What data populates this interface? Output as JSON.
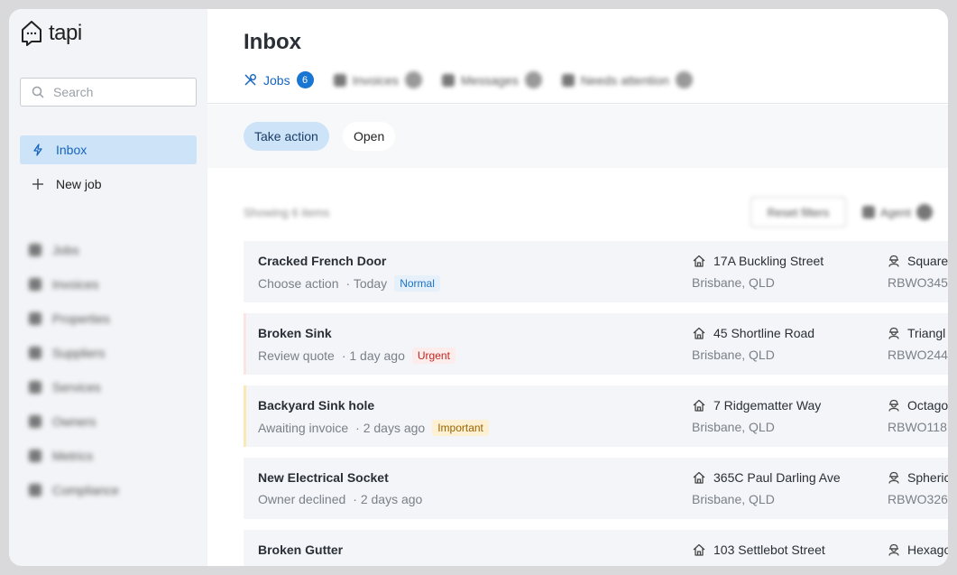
{
  "brand": {
    "name": "tapi"
  },
  "search": {
    "placeholder": "Search"
  },
  "nav": {
    "primary": [
      {
        "label": "Inbox",
        "icon": "lightning-icon",
        "active": true
      },
      {
        "label": "New job",
        "icon": "plus-icon",
        "active": false
      }
    ],
    "secondary": [
      "Jobs",
      "Invoices",
      "Properties",
      "Suppliers",
      "Services",
      "Owners",
      "Metrics",
      "Compliance"
    ]
  },
  "page": {
    "title": "Inbox"
  },
  "tabs": [
    {
      "label": "Jobs",
      "count": "6",
      "icon": "tools-icon"
    },
    {
      "label": "Invoices",
      "count": "",
      "icon": "document-icon"
    },
    {
      "label": "Messages",
      "count": "",
      "icon": "headphones-icon"
    },
    {
      "label": "Needs attention",
      "count": "",
      "icon": "user-icon"
    }
  ],
  "filters": {
    "take_action": "Take action",
    "open": "Open"
  },
  "toolbar": {
    "showing": "Showing 6 items",
    "reset": "Reset filters",
    "agent": "Agent"
  },
  "jobs": [
    {
      "title": "Cracked French Door",
      "status": "Choose action",
      "time": "· Today",
      "tag": "Normal",
      "address": "17A Buckling Street",
      "city": "Brisbane, QLD",
      "supplier": "Square",
      "ref": "RBWO345"
    },
    {
      "title": "Broken Sink",
      "status": "Review quote",
      "time": "· 1 day ago",
      "tag": "Urgent",
      "address": "45 Shortline Road",
      "city": "Brisbane, QLD",
      "supplier": "Triangl",
      "ref": "RBWO244"
    },
    {
      "title": "Backyard Sink hole",
      "status": "Awaiting invoice",
      "time": "· 2 days ago",
      "tag": "Important",
      "address": "7 Ridgematter Way",
      "city": "Brisbane, QLD",
      "supplier": "Octago",
      "ref": "RBWO118"
    },
    {
      "title": "New Electrical Socket",
      "status": "Owner declined",
      "time": "· 2 days ago",
      "tag": "",
      "address": "365C Paul Darling Ave",
      "city": "Brisbane, QLD",
      "supplier": "Spheric",
      "ref": "RBWO326"
    },
    {
      "title": "Broken Gutter",
      "status": "",
      "time": "",
      "tag": "",
      "address": "103 Settlebot Street",
      "city": "",
      "supplier": "Hexago",
      "ref": ""
    }
  ]
}
